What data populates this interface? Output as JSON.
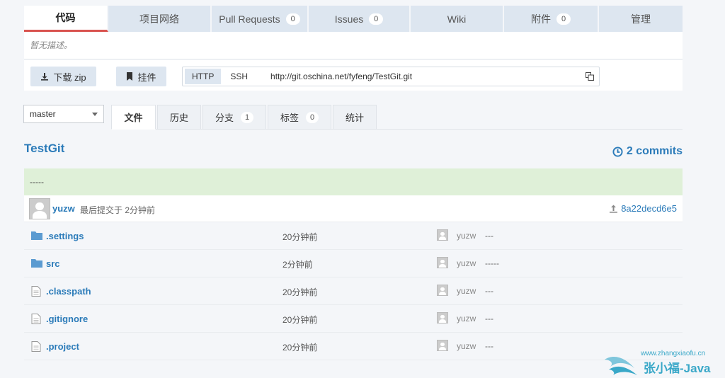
{
  "top_tabs": [
    {
      "label": "代码",
      "count": null,
      "active": true
    },
    {
      "label": "项目网络",
      "count": null,
      "active": false
    },
    {
      "label": "Pull Requests",
      "count": "0",
      "active": false
    },
    {
      "label": "Issues",
      "count": "0",
      "active": false
    },
    {
      "label": "Wiki",
      "count": null,
      "active": false
    },
    {
      "label": "附件",
      "count": "0",
      "active": false
    },
    {
      "label": "管理",
      "count": null,
      "active": false
    }
  ],
  "description": "暂无描述。",
  "actions": {
    "download_label": "下载 zip",
    "mount_label": "挂件",
    "http_label": "HTTP",
    "ssh_label": "SSH",
    "clone_url": "http://git.oschina.net/fyfeng/TestGit.git"
  },
  "branch": {
    "selected": "master"
  },
  "sub_tabs": [
    {
      "label": "文件",
      "count": null,
      "active": true
    },
    {
      "label": "历史",
      "count": null,
      "active": false
    },
    {
      "label": "分支",
      "count": "1",
      "active": false
    },
    {
      "label": "标签",
      "count": "0",
      "active": false
    },
    {
      "label": "统计",
      "count": null,
      "active": false
    }
  ],
  "repo": {
    "name": "TestGit",
    "commits": "2 commits"
  },
  "last_commit": {
    "message": "-----",
    "author": "yuzw",
    "meta": "最后提交于 2分钟前",
    "hash": "8a22decd6e5"
  },
  "files": [
    {
      "type": "folder",
      "name": ".settings",
      "time": "20分钟前",
      "author": "yuzw",
      "message": "---"
    },
    {
      "type": "folder",
      "name": "src",
      "time": "2分钟前",
      "author": "yuzw",
      "message": "-----"
    },
    {
      "type": "file",
      "name": ".classpath",
      "time": "20分钟前",
      "author": "yuzw",
      "message": "---"
    },
    {
      "type": "file",
      "name": ".gitignore",
      "time": "20分钟前",
      "author": "yuzw",
      "message": "---"
    },
    {
      "type": "file",
      "name": ".project",
      "time": "20分钟前",
      "author": "yuzw",
      "message": "---"
    }
  ],
  "watermark": {
    "url": "www.zhangxiaofu.cn",
    "text": "张小福-Java"
  },
  "colors": {
    "accent": "#2b7bb9",
    "active_tab_border": "#d9534f",
    "message_bar": "#dff0d8",
    "tab_bg": "#dde6f0"
  }
}
